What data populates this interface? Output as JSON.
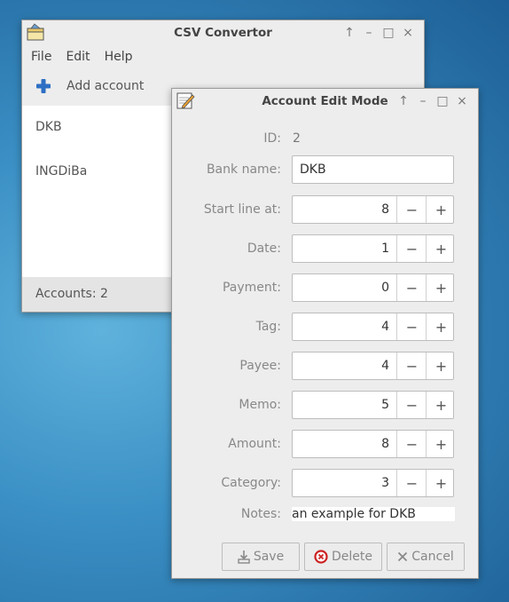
{
  "main_window": {
    "title": "CSV Convertor",
    "menu": [
      "File",
      "Edit",
      "Help"
    ],
    "toolbar": {
      "add_label": "Add account"
    },
    "accounts": [
      "DKB",
      "INGDiBa"
    ],
    "status": "Accounts: 2"
  },
  "dialog": {
    "title": "Account Edit Mode",
    "id_label": "ID:",
    "id_value": "2",
    "bank_label": "Bank name:",
    "bank_value": "DKB",
    "spinners": [
      {
        "label": "Start line at:",
        "value": "8"
      },
      {
        "label": "Date:",
        "value": "1"
      },
      {
        "label": "Payment:",
        "value": "0"
      },
      {
        "label": "Tag:",
        "value": "4"
      },
      {
        "label": "Payee:",
        "value": "4"
      },
      {
        "label": "Memo:",
        "value": "5"
      },
      {
        "label": "Amount:",
        "value": "8"
      },
      {
        "label": "Category:",
        "value": "3"
      }
    ],
    "notes_label": "Notes:",
    "notes_value": "an example for DKB",
    "buttons": {
      "save": "Save",
      "delete": "Delete",
      "cancel": "Cancel"
    }
  },
  "window_controls": {
    "up": "↑",
    "minimize": "–",
    "maximize": "□",
    "close": "×"
  },
  "spin_glyphs": {
    "minus": "−",
    "plus": "+"
  },
  "colors": {
    "accent_blue": "#2d6fc4",
    "delete_red": "#cc2222"
  }
}
